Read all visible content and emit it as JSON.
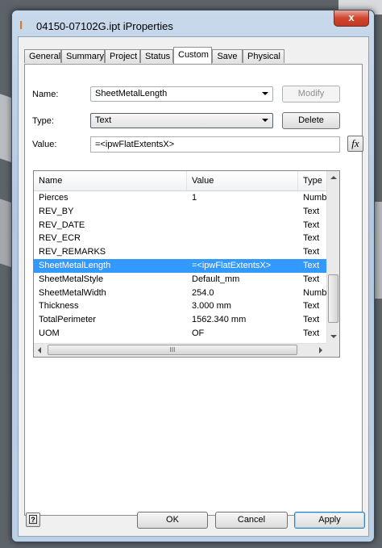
{
  "window": {
    "title": "04150-07102G.ipt iProperties",
    "close_glyph": "x"
  },
  "tabs": [
    {
      "label": "General"
    },
    {
      "label": "Summary"
    },
    {
      "label": "Project"
    },
    {
      "label": "Status"
    },
    {
      "label": "Custom",
      "active": true
    },
    {
      "label": "Save"
    },
    {
      "label": "Physical"
    }
  ],
  "form": {
    "name_label": "Name:",
    "name_value": "SheetMetalLength",
    "modify_label": "Modify",
    "type_label": "Type:",
    "type_value": "Text",
    "delete_label": "Delete",
    "value_label": "Value:",
    "value_value": "=<ipwFlatExtentsX>",
    "fx_label": "fx"
  },
  "table": {
    "columns": [
      "Name",
      "Value",
      "Type"
    ],
    "rows": [
      {
        "name": "Pierces",
        "value": "1",
        "type": "Number"
      },
      {
        "name": "REV_BY",
        "value": "",
        "type": "Text"
      },
      {
        "name": "REV_DATE",
        "value": "",
        "type": "Text"
      },
      {
        "name": "REV_ECR",
        "value": "",
        "type": "Text"
      },
      {
        "name": "REV_REMARKS",
        "value": "",
        "type": "Text"
      },
      {
        "name": "SheetMetalLength",
        "value": "=<ipwFlatExtentsX>",
        "type": "Text",
        "selected": true
      },
      {
        "name": "SheetMetalStyle",
        "value": "Default_mm",
        "type": "Text"
      },
      {
        "name": "SheetMetalWidth",
        "value": "254.0",
        "type": "Number"
      },
      {
        "name": "Thickness",
        "value": "3.000 mm",
        "type": "Text"
      },
      {
        "name": "TotalPerimeter",
        "value": "1562.340 mm",
        "type": "Text"
      },
      {
        "name": "UOM",
        "value": "OF",
        "type": "Text"
      }
    ],
    "scroll_grip": "III"
  },
  "footer": {
    "help_glyph": "?",
    "ok_label": "OK",
    "cancel_label": "Cancel",
    "apply_label": "Apply"
  },
  "colors": {
    "selection": "#3399ff",
    "app_icon": "#e07b14"
  }
}
